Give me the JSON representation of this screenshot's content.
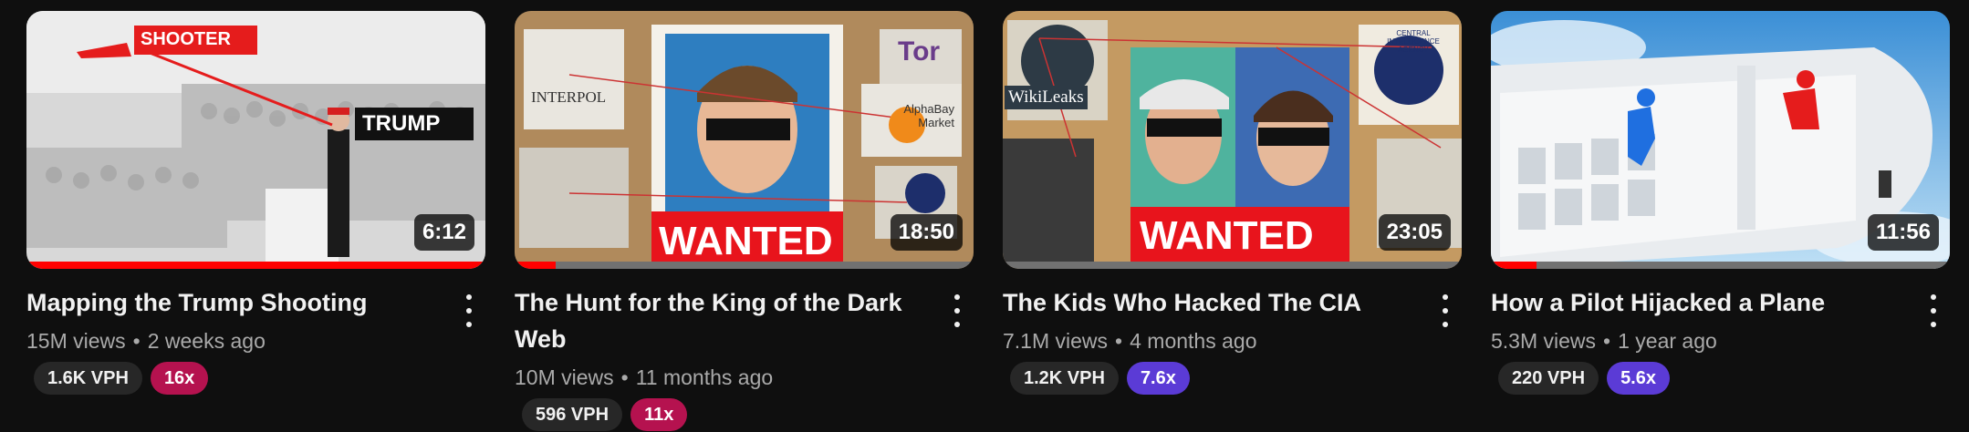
{
  "videos": [
    {
      "title": "Mapping the Trump Shooting",
      "views": "15M views",
      "age": "2 weeks ago",
      "duration": "6:12",
      "progress": 1.0,
      "vph": "1.6K VPH",
      "multiplier": "16x",
      "multiplier_color": "#b5124f",
      "thumb_labels": [
        "SHOOTER",
        "TRUMP"
      ]
    },
    {
      "title": "The Hunt for the King of the Dark Web",
      "views": "10M views",
      "age": "11 months ago",
      "duration": "18:50",
      "progress": 0.09,
      "vph": "596 VPH",
      "multiplier": "11x",
      "multiplier_color": "#b5124f",
      "thumb_labels": [
        "WANTED",
        "INTERPOL",
        "AlphaBay Market",
        "Tor"
      ]
    },
    {
      "title": "The Kids Who Hacked The CIA",
      "views": "7.1M views",
      "age": "4 months ago",
      "duration": "23:05",
      "progress": 0.0,
      "vph": "1.2K VPH",
      "multiplier": "7.6x",
      "multiplier_color": "#5b3bd6",
      "thumb_labels": [
        "WANTED",
        "WikiLeaks",
        "CENTRAL INTELLIGENCE AGENCY"
      ]
    },
    {
      "title": "How a Pilot Hijacked a Plane",
      "views": "5.3M views",
      "age": "1 year ago",
      "duration": "11:56",
      "progress": 0.1,
      "vph": "220 VPH",
      "multiplier": "5.6x",
      "multiplier_color": "#5b3bd6",
      "thumb_labels": []
    }
  ],
  "separator": "•",
  "icons": {
    "more": "more-vert-icon"
  }
}
